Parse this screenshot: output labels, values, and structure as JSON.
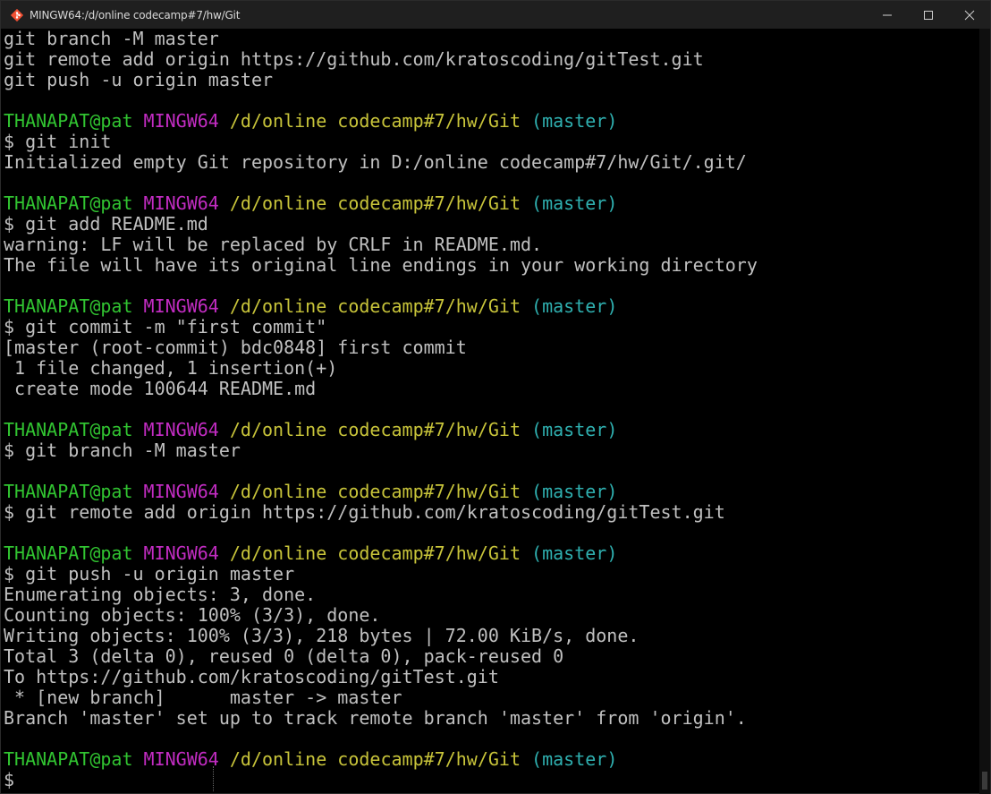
{
  "window": {
    "title": "MINGW64:/d/online codecamp#7/hw/Git",
    "icon": "git-bash-icon",
    "controls": [
      "minimize-icon",
      "maximize-icon",
      "close-icon"
    ]
  },
  "colors": {
    "user": "#31c431",
    "msystem": "#c22cc2",
    "path": "#c8c43a",
    "branch": "#2fb0b0",
    "text": "#c0c0c0",
    "background": "#000000"
  },
  "prompt": {
    "user": "THANAPAT@pat",
    "msystem": "MINGW64",
    "path": "/d/online codecamp#7/hw/Git",
    "branch": "(master)"
  },
  "terminal": {
    "lines": [
      {
        "type": "text",
        "text": "git branch -M master"
      },
      {
        "type": "text",
        "text": "git remote add origin https://github.com/kratoscoding/gitTest.git"
      },
      {
        "type": "text",
        "text": "git push -u origin master"
      },
      {
        "type": "blank",
        "text": ""
      },
      {
        "type": "prompt"
      },
      {
        "type": "text",
        "text": "$ git init"
      },
      {
        "type": "text",
        "text": "Initialized empty Git repository in D:/online codecamp#7/hw/Git/.git/"
      },
      {
        "type": "blank",
        "text": ""
      },
      {
        "type": "prompt"
      },
      {
        "type": "text",
        "text": "$ git add README.md"
      },
      {
        "type": "text",
        "text": "warning: LF will be replaced by CRLF in README.md."
      },
      {
        "type": "text",
        "text": "The file will have its original line endings in your working directory"
      },
      {
        "type": "blank",
        "text": ""
      },
      {
        "type": "prompt"
      },
      {
        "type": "text",
        "text": "$ git commit -m \"first commit\""
      },
      {
        "type": "text",
        "text": "[master (root-commit) bdc0848] first commit"
      },
      {
        "type": "text",
        "text": " 1 file changed, 1 insertion(+)"
      },
      {
        "type": "text",
        "text": " create mode 100644 README.md"
      },
      {
        "type": "blank",
        "text": ""
      },
      {
        "type": "prompt"
      },
      {
        "type": "text",
        "text": "$ git branch -M master"
      },
      {
        "type": "blank",
        "text": ""
      },
      {
        "type": "prompt"
      },
      {
        "type": "text",
        "text": "$ git remote add origin https://github.com/kratoscoding/gitTest.git"
      },
      {
        "type": "blank",
        "text": ""
      },
      {
        "type": "prompt"
      },
      {
        "type": "text",
        "text": "$ git push -u origin master"
      },
      {
        "type": "text",
        "text": "Enumerating objects: 3, done."
      },
      {
        "type": "text",
        "text": "Counting objects: 100% (3/3), done."
      },
      {
        "type": "text",
        "text": "Writing objects: 100% (3/3), 218 bytes | 72.00 KiB/s, done."
      },
      {
        "type": "text",
        "text": "Total 3 (delta 0), reused 0 (delta 0), pack-reused 0"
      },
      {
        "type": "text",
        "text": "To https://github.com/kratoscoding/gitTest.git"
      },
      {
        "type": "text",
        "text": " * [new branch]      master -> master"
      },
      {
        "type": "text",
        "text": "Branch 'master' set up to track remote branch 'master' from 'origin'."
      },
      {
        "type": "blank",
        "text": ""
      },
      {
        "type": "prompt"
      },
      {
        "type": "text",
        "text": "$"
      }
    ]
  }
}
